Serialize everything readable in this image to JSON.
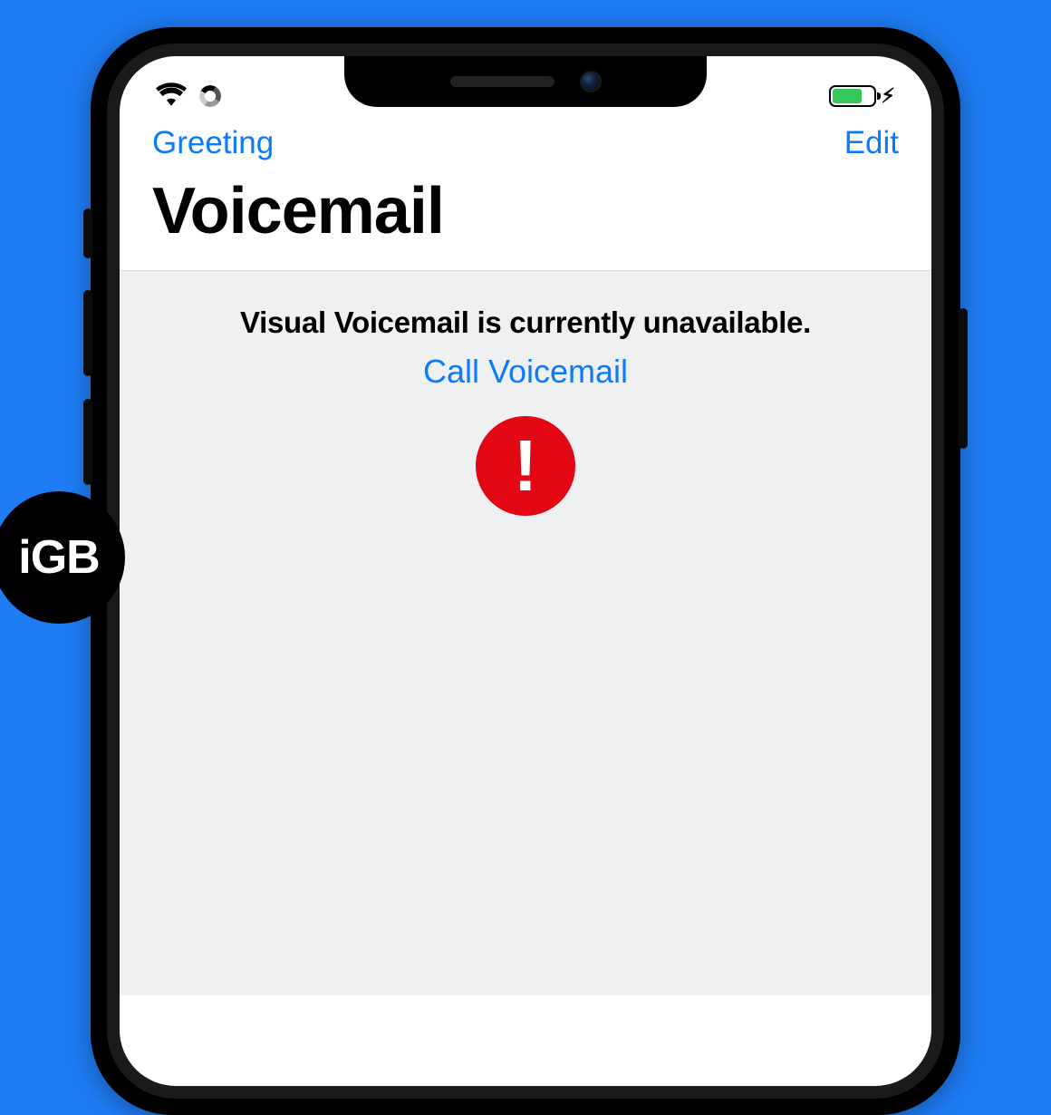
{
  "nav": {
    "greeting": "Greeting",
    "edit": "Edit"
  },
  "title": "Voicemail",
  "content": {
    "error_message": "Visual Voicemail is currently unavailable.",
    "call_link": "Call Voicemail"
  },
  "status": {
    "battery_percent": 74,
    "charging": true
  },
  "logo": {
    "text": "iGB"
  },
  "colors": {
    "background": "#1e7df5",
    "ios_blue": "#0a7aff",
    "battery_green": "#34c759",
    "alert_red": "#e30613"
  },
  "icons": {
    "wifi": "wifi-icon",
    "spinner": "loading-spinner-icon",
    "battery": "battery-icon",
    "bolt": "charging-bolt-icon",
    "alert": "exclamation-icon"
  }
}
